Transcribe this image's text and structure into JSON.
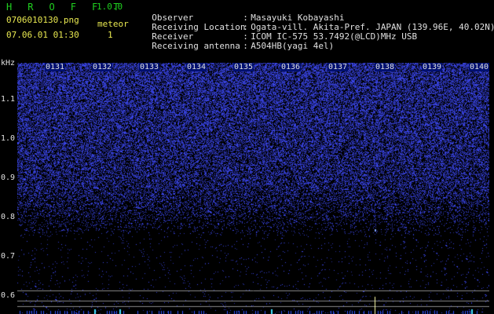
{
  "header": {
    "app_title": "H R O F F T",
    "version": "1.0.0",
    "filename": "0706010130.png",
    "meteor_label": "meteor",
    "meteor_count": "1",
    "datetime": "07.06.01 01:30"
  },
  "info": [
    {
      "key": "Observer",
      "value": "Masayuki Kobayashi"
    },
    {
      "key": "Receiving Location",
      "value": "Ogata-vill. Akita-Pref. JAPAN (139.96E, 40.02N)"
    },
    {
      "key": "Receiver",
      "value": "ICOM IC-575 53.7492(@LCD)MHz USB"
    },
    {
      "key": "Receiving antenna",
      "value": "A504HB(yagi 4el)"
    }
  ],
  "axis": {
    "y_unit": "kHz",
    "y_ticks": [
      "1.1",
      "1.0",
      "0.9",
      "0.8",
      "0.7",
      "0.6"
    ],
    "x_ticks": [
      "0131",
      "0132",
      "0133",
      "0134",
      "0135",
      "0136",
      "0137",
      "0138",
      "0139",
      "0140"
    ]
  },
  "colors": {
    "noise": "#2a3cff",
    "background": "#000000",
    "meteor_echo": "#ffffaa"
  }
}
